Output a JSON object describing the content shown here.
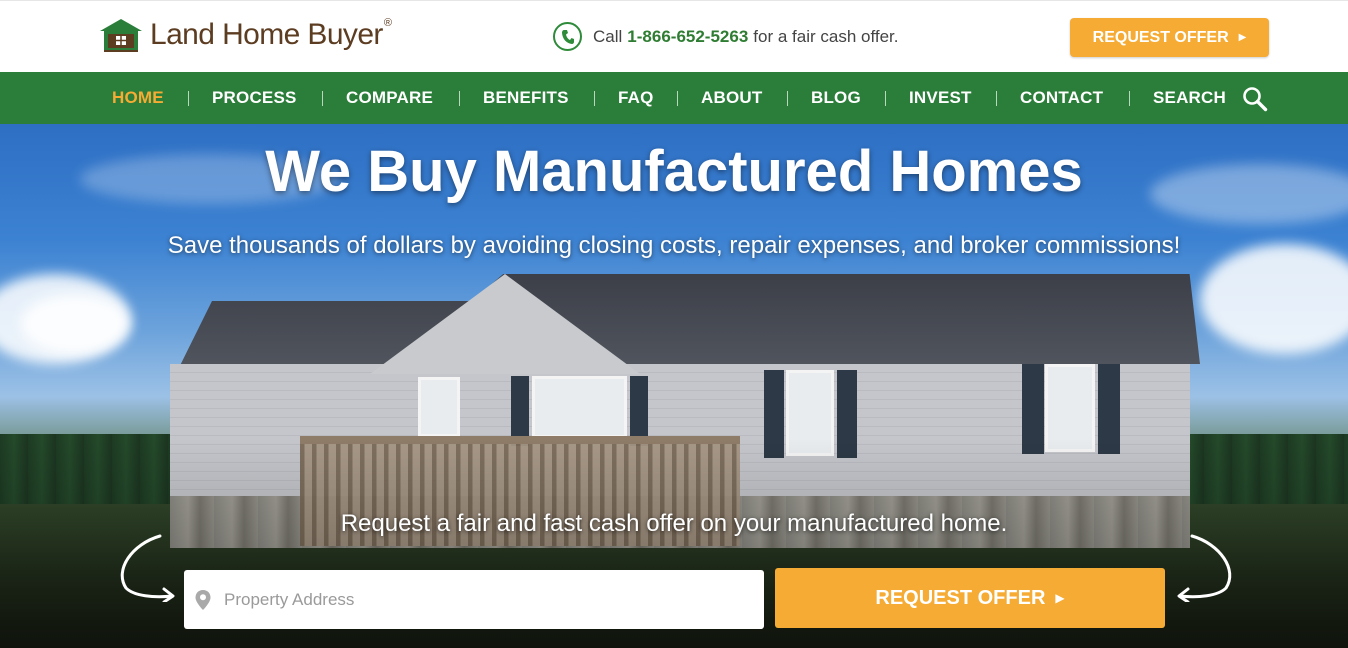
{
  "header": {
    "logo_text": "Land Home Buyer",
    "logo_reg": "®",
    "phone_prefix": "Call",
    "phone_number": "1-866-652-5263",
    "phone_suffix": "for a fair cash offer.",
    "request_button": "REQUEST OFFER"
  },
  "nav": {
    "items": [
      {
        "label": "HOME",
        "active": true
      },
      {
        "label": "PROCESS"
      },
      {
        "label": "COMPARE"
      },
      {
        "label": "BENEFITS"
      },
      {
        "label": "FAQ"
      },
      {
        "label": "ABOUT"
      },
      {
        "label": "BLOG"
      },
      {
        "label": "INVEST"
      },
      {
        "label": "CONTACT"
      },
      {
        "label": "SEARCH"
      }
    ]
  },
  "hero": {
    "title": "We Buy Manufactured Homes",
    "subtitle": "Save thousands of dollars by avoiding closing costs, repair expenses, and broker commissions!",
    "cta_text": "Request a fair and fast cash offer on your manufactured home.",
    "address_placeholder": "Property Address",
    "request_button": "REQUEST OFFER"
  },
  "colors": {
    "brand_green": "#2a7e39",
    "accent_orange": "#f5ab34",
    "logo_brown": "#5c3d22"
  },
  "icons": [
    "house-logo-icon",
    "phone-icon",
    "caret-right-icon",
    "search-icon",
    "map-pin-icon",
    "curved-arrow-icon"
  ]
}
